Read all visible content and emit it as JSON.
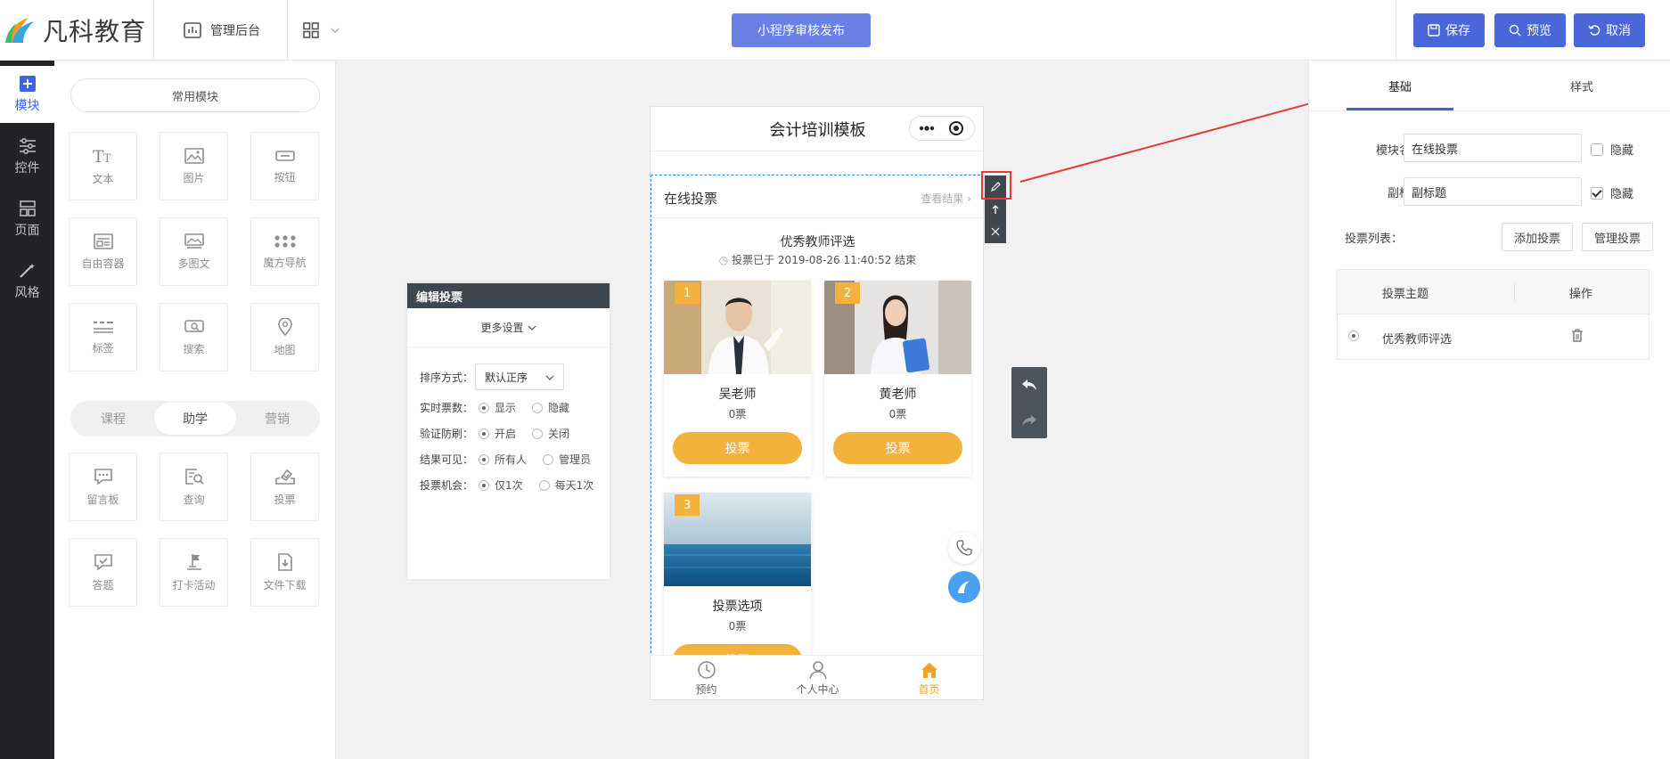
{
  "header": {
    "logo_text": "凡科教育",
    "admin_label": "管理后台",
    "publish_label": "小程序审核发布",
    "save_label": "保存",
    "preview_label": "预览",
    "cancel_label": "取消",
    "accent": "#4a66d8"
  },
  "rail": {
    "items": [
      {
        "label": "模块",
        "icon": "plus-square-icon"
      },
      {
        "label": "控件",
        "icon": "sliders-icon"
      },
      {
        "label": "页面",
        "icon": "layout-icon"
      },
      {
        "label": "风格",
        "icon": "magic-wand-icon"
      }
    ]
  },
  "modules": {
    "common_label": "常用模块",
    "common": [
      {
        "label": "文本",
        "icon": "text-icon"
      },
      {
        "label": "图片",
        "icon": "image-icon"
      },
      {
        "label": "按钮",
        "icon": "button-icon"
      },
      {
        "label": "自由容器",
        "icon": "container-icon"
      },
      {
        "label": "多图文",
        "icon": "multi-image-icon"
      },
      {
        "label": "魔方导航",
        "icon": "grid-dots-icon"
      },
      {
        "label": "标签",
        "icon": "tag-icon"
      },
      {
        "label": "搜索",
        "icon": "search-icon"
      },
      {
        "label": "地图",
        "icon": "map-pin-icon"
      }
    ],
    "segments": [
      "课程",
      "助学",
      "营销"
    ],
    "active_segment": "助学",
    "study": [
      {
        "label": "留言板",
        "icon": "message-board-icon"
      },
      {
        "label": "查询",
        "icon": "query-icon"
      },
      {
        "label": "投票",
        "icon": "vote-icon"
      },
      {
        "label": "答题",
        "icon": "answer-icon"
      },
      {
        "label": "打卡活动",
        "icon": "checkin-flag-icon"
      },
      {
        "label": "文件下载",
        "icon": "file-download-icon"
      }
    ]
  },
  "edit_panel": {
    "title": "编辑投票",
    "more_settings": "更多设置",
    "sort_label": "排序方式：",
    "sort_value": "默认正序",
    "rows": [
      {
        "label": "实时票数：",
        "opt1": "显示",
        "opt2": "隐藏"
      },
      {
        "label": "验证防刷：",
        "opt1": "开启",
        "opt2": "关闭"
      },
      {
        "label": "结果可见：",
        "opt1": "所有人",
        "opt2": "管理员"
      },
      {
        "label": "投票机会：",
        "opt1": "仅1次",
        "opt2": "每天1次"
      }
    ]
  },
  "phone": {
    "title": "会计培训模板",
    "module_title": "在线投票",
    "view_result": "查看结果",
    "vote_title": "优秀教师评选",
    "vote_time": "投票已于 2019-08-26 11:40:52 结束",
    "vote_button": "投票",
    "cards": [
      {
        "rank": "1",
        "name": "吴老师",
        "votes": "0票"
      },
      {
        "rank": "2",
        "name": "黄老师",
        "votes": "0票"
      },
      {
        "rank": "3",
        "name": "投票选项",
        "votes": "0票"
      }
    ],
    "tabs": [
      {
        "label": "预约",
        "icon": "clock-icon"
      },
      {
        "label": "个人中心",
        "icon": "user-icon"
      },
      {
        "label": "首页",
        "icon": "home-icon"
      }
    ],
    "active_tab": "首页",
    "highlight": "#f3b23b"
  },
  "settings": {
    "tab_basic": "基础",
    "tab_style": "样式",
    "name_label": "模块名称：",
    "name_value": "在线投票",
    "subtitle_label": "副标题：",
    "subtitle_value": "副标题",
    "hide_label": "隐藏",
    "name_hidden": false,
    "subtitle_hidden": true,
    "list_label": "投票列表：",
    "add_vote": "添加投票",
    "manage_vote": "管理投票",
    "table_head_topic": "投票主题",
    "table_head_action": "操作",
    "rows": [
      {
        "topic": "优秀教师评选"
      }
    ]
  }
}
